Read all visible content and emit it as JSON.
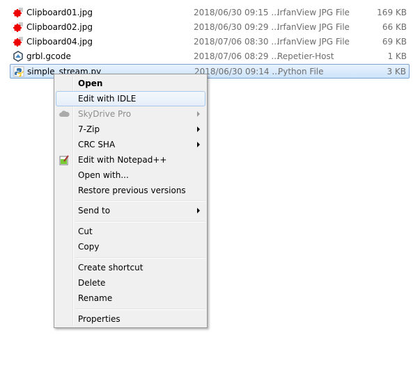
{
  "files": [
    {
      "name": "Clipboard01.jpg",
      "date": "2018/06/30 09:15 ...",
      "type": "IrfanView JPG File",
      "size": "169 KB",
      "icon": "irfanview-icon"
    },
    {
      "name": "Clipboard02.jpg",
      "date": "2018/06/30 09:29 ...",
      "type": "IrfanView JPG File",
      "size": "66 KB",
      "icon": "irfanview-icon"
    },
    {
      "name": "Clipboard04.jpg",
      "date": "2018/07/06 08:30 ...",
      "type": "IrfanView JPG File",
      "size": "69 KB",
      "icon": "irfanview-icon"
    },
    {
      "name": "grbl.gcode",
      "date": "2018/07/06 08:29 ...",
      "type": "Repetier-Host",
      "size": "1 KB",
      "icon": "repetier-icon"
    },
    {
      "name": "simple_stream.py",
      "date": "2018/06/30 09:14 ...",
      "type": "Python File",
      "size": "3 KB",
      "icon": "python-icon",
      "selected": true
    }
  ],
  "menu": {
    "open": "Open",
    "edit_idle": "Edit with IDLE",
    "skydrive": "SkyDrive Pro",
    "zip": "7-Zip",
    "crc": "CRC SHA",
    "notepad": "Edit with Notepad++",
    "open_with": "Open with...",
    "restore": "Restore previous versions",
    "send_to": "Send to",
    "cut": "Cut",
    "copy": "Copy",
    "create_shortcut": "Create shortcut",
    "delete": "Delete",
    "rename": "Rename",
    "properties": "Properties"
  }
}
